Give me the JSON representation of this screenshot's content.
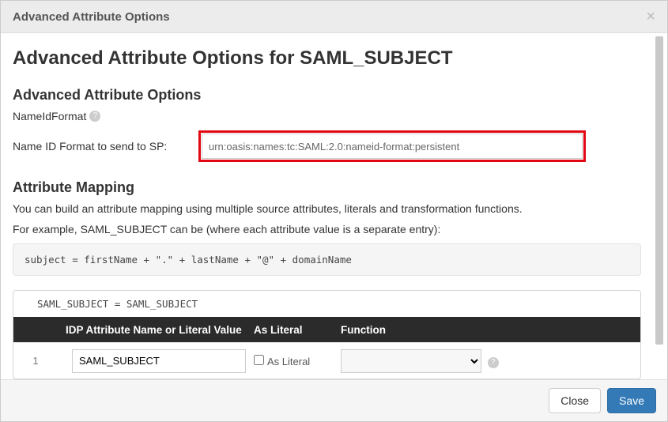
{
  "modal": {
    "header_title": "Advanced Attribute Options",
    "close_glyph": "×"
  },
  "page": {
    "title": "Advanced Attribute Options for SAML_SUBJECT"
  },
  "adv": {
    "heading": "Advanced Attribute Options",
    "nameid_label": "NameIdFormat",
    "field_label": "Name ID Format to send to SP:",
    "field_value": "urn:oasis:names:tc:SAML:2.0:nameid-format:persistent"
  },
  "mapping": {
    "heading": "Attribute Mapping",
    "desc1": "You can build an attribute mapping using multiple source attributes, literals and transformation functions.",
    "desc2": "For example, SAML_SUBJECT can be (where each attribute value is a separate entry):",
    "example": "subject = firstName + \".\" + lastName + \"@\" + domainName",
    "current_expr": "SAML_SUBJECT = SAML_SUBJECT",
    "columns": {
      "attr": "IDP Attribute Name or Literal Value",
      "literal": "As Literal",
      "func": "Function"
    },
    "rows": [
      {
        "index": "1",
        "value": "SAML_SUBJECT",
        "as_literal_label": "As Literal",
        "func": ""
      }
    ]
  },
  "footer": {
    "close": "Close",
    "save": "Save"
  },
  "icons": {
    "help": "?"
  }
}
